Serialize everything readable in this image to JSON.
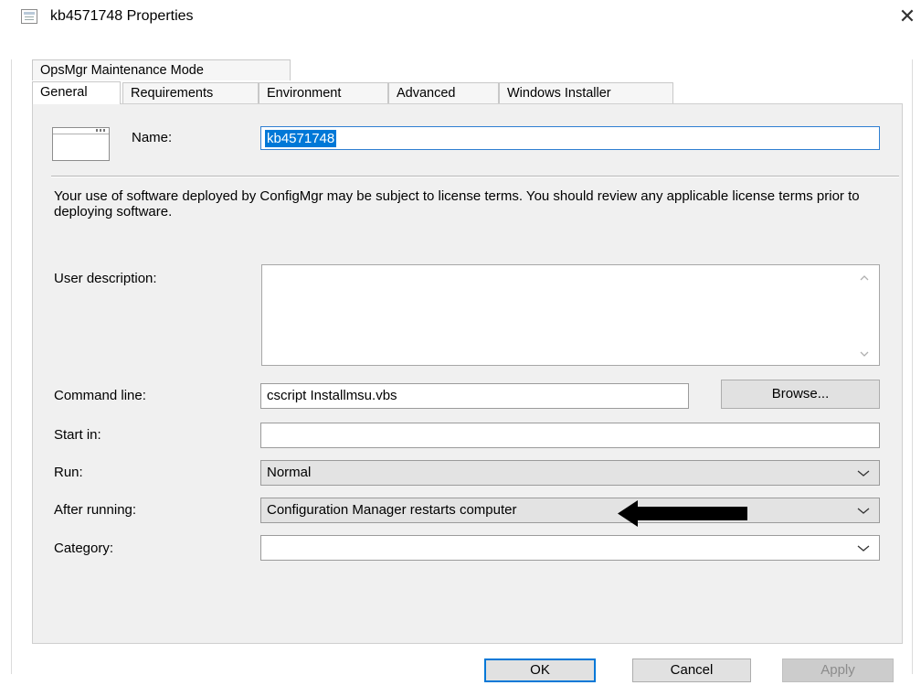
{
  "window": {
    "title": "kb4571748 Properties",
    "close_glyph": "✕"
  },
  "tabs": {
    "row1": [
      {
        "label": "OpsMgr Maintenance Mode"
      }
    ],
    "row2": [
      {
        "label": "General",
        "active": true
      },
      {
        "label": "Requirements"
      },
      {
        "label": "Environment"
      },
      {
        "label": "Advanced"
      },
      {
        "label": "Windows Installer"
      }
    ]
  },
  "general": {
    "name_label": "Name:",
    "name_value": "kb4571748",
    "notice": "Your use of software deployed by ConfigMgr may be subject to license terms. You should review any applicable license terms prior to deploying software.",
    "user_description_label": "User description:",
    "user_description_value": "",
    "command_line_label": "Command line:",
    "command_line_value": "cscript Installmsu.vbs",
    "browse_label": "Browse...",
    "start_in_label": "Start in:",
    "start_in_value": "",
    "run_label": "Run:",
    "run_value": "Normal",
    "after_running_label": "After running:",
    "after_running_value": "Configuration Manager restarts computer",
    "category_label": "Category:",
    "category_value": ""
  },
  "buttons": {
    "ok": "OK",
    "cancel": "Cancel",
    "apply": "Apply"
  },
  "icons": {
    "title": "properties-window-icon",
    "program": "program-window-icon",
    "annotation": "black-arrow-pointing-left"
  },
  "colors": {
    "selection": "#0078d7",
    "focus_border": "#0078d7",
    "panel": "#f0f0f0",
    "annotation_arrow": "#000000"
  }
}
